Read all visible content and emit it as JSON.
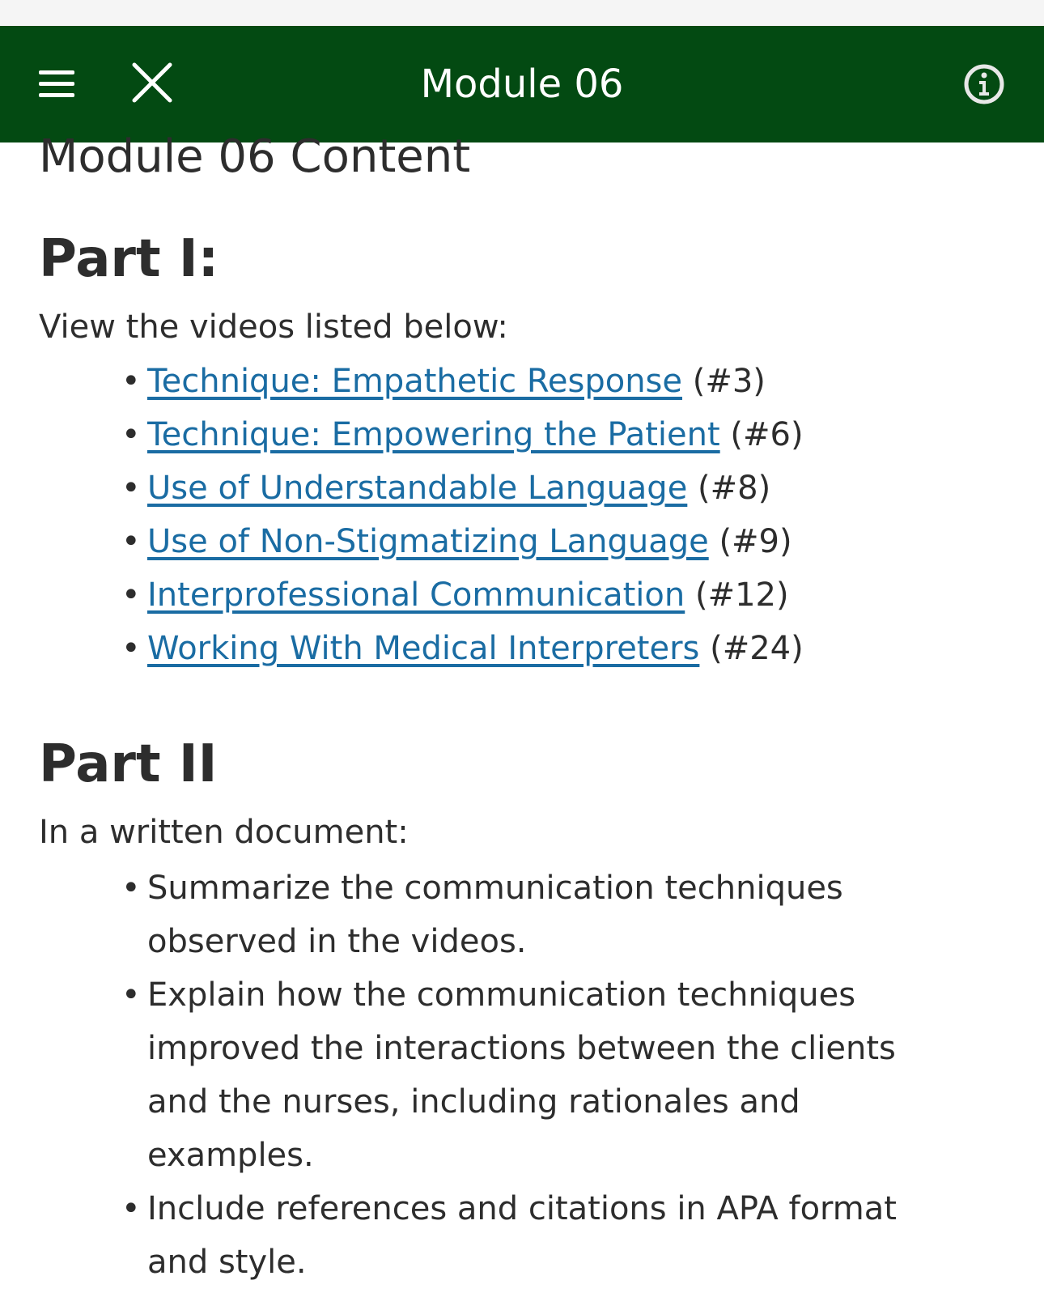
{
  "top_bar": {
    "title": "Module 06",
    "colors": {
      "background": "#034a12",
      "text": "#ffffff"
    },
    "icons": {
      "menu": "hamburger-icon",
      "close": "close-icon",
      "info": "info-icon"
    }
  },
  "page": {
    "heading": "Module 06 Content",
    "part1": {
      "title": "Part I:",
      "intro": "View the videos listed below:",
      "videos": [
        {
          "link": "Technique: Empathetic Response",
          "num": "(#3)"
        },
        {
          "link": "Technique: Empowering the Patient",
          "num": "(#6)"
        },
        {
          "link": "Use of Understandable Language",
          "num": "(#8)"
        },
        {
          "link": "Use of Non-Stigmatizing Language",
          "num": "(#9)"
        },
        {
          "link": "Interprofessional Communication",
          "num": "(#12)"
        },
        {
          "link": "Working With Medical Interpreters",
          "num": "(#24)"
        }
      ]
    },
    "part2": {
      "title": "Part II",
      "intro": "In a written document:",
      "tasks": [
        "Summarize the communication techniques observed in the videos.",
        "Explain how the communication techniques improved the interactions between the clients and the nurses, including rationales and examples.",
        "Include references and citations in APA format and style."
      ]
    },
    "colors": {
      "link": "#1a6ca3",
      "text": "#2d2d2d"
    }
  }
}
